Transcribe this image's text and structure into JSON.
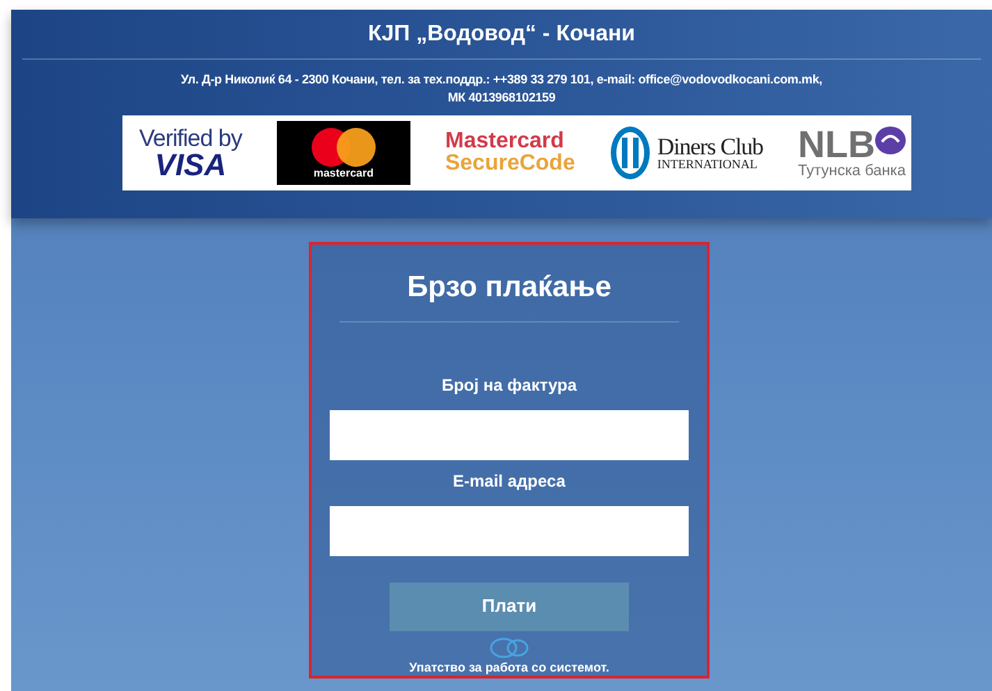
{
  "header": {
    "title": "КЈП „Водовод“ - Кочани",
    "address_lines": [
      "Ул. Д-р Николиќ 64 - 2300 Кочани, тел. за тех.поддр.: ++389 33 279 101, e-mail: office@vodovodkocani.com.mk,",
      "МК 4013968102159"
    ],
    "logos": [
      {
        "kind": "visa",
        "texts": [
          "Verified by",
          "VISA"
        ]
      },
      {
        "kind": "mastercard",
        "texts": [
          "mastercard"
        ]
      },
      {
        "kind": "securecode",
        "texts": [
          "Mastercard",
          "SecureCode"
        ]
      },
      {
        "kind": "diners",
        "texts": [
          "Diners Club",
          "INTERNATIONAL"
        ]
      },
      {
        "kind": "nlb",
        "texts": [
          "NLB",
          "Тутунска банка"
        ]
      }
    ]
  },
  "form": {
    "title": "Брзо плаќање",
    "fields": [
      {
        "label": "Број на фактура"
      },
      {
        "label": "E-mail адреса"
      }
    ],
    "submit": "Плати",
    "help_link": "Упатство за работа со системот."
  }
}
